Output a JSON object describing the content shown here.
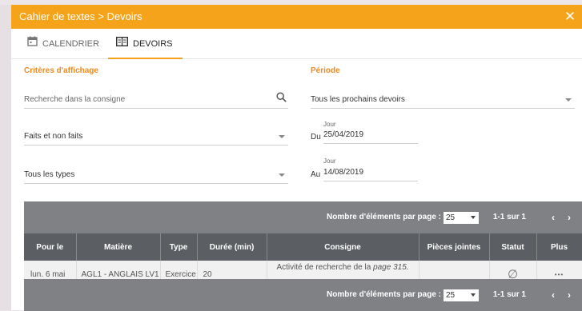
{
  "window": {
    "title": "Cahier de textes > Devoirs",
    "close_icon": "close-icon"
  },
  "tabs": [
    {
      "label": "CALENDRIER",
      "icon": "calendar-icon",
      "active": false
    },
    {
      "label": "DEVOIRS",
      "icon": "book-icon",
      "active": true
    }
  ],
  "criteria": {
    "heading": "Critères d'affichage",
    "search_placeholder": "Recherche dans la consigne",
    "status_filter": "Faits et non faits",
    "type_filter": "Tous les types"
  },
  "period": {
    "heading": "Période",
    "range": "Tous les prochains devoirs",
    "from_prefix": "Du",
    "from_label": "Jour",
    "from_date": "25/04/2019",
    "to_prefix": "Au",
    "to_label": "Jour",
    "to_date": "14/08/2019"
  },
  "pager": {
    "label": "Nombre d'éléments par page :",
    "per_page": "25",
    "count": "1-1 sur 1",
    "prev": "‹",
    "next": "›"
  },
  "table": {
    "headers": [
      "Pour le",
      "Matière",
      "Type",
      "Durée (min)",
      "Consigne",
      "Pièces jointes",
      "Statut",
      "Plus"
    ],
    "rows": [
      {
        "pour_le": "lun. 6 mai",
        "matiere": "AGL1 - ANGLAIS LV1",
        "type": "Exercice",
        "duree": "20",
        "consigne_text": "Activité de recherche de la ",
        "consigne_italic": "page 315.",
        "pieces": "",
        "statut": "∅",
        "plus": "•••"
      }
    ]
  },
  "colors": {
    "accent": "#f5a31a",
    "label": "#f08a1c",
    "grid_header": "#5b5e62",
    "pager": "#7f8184"
  }
}
